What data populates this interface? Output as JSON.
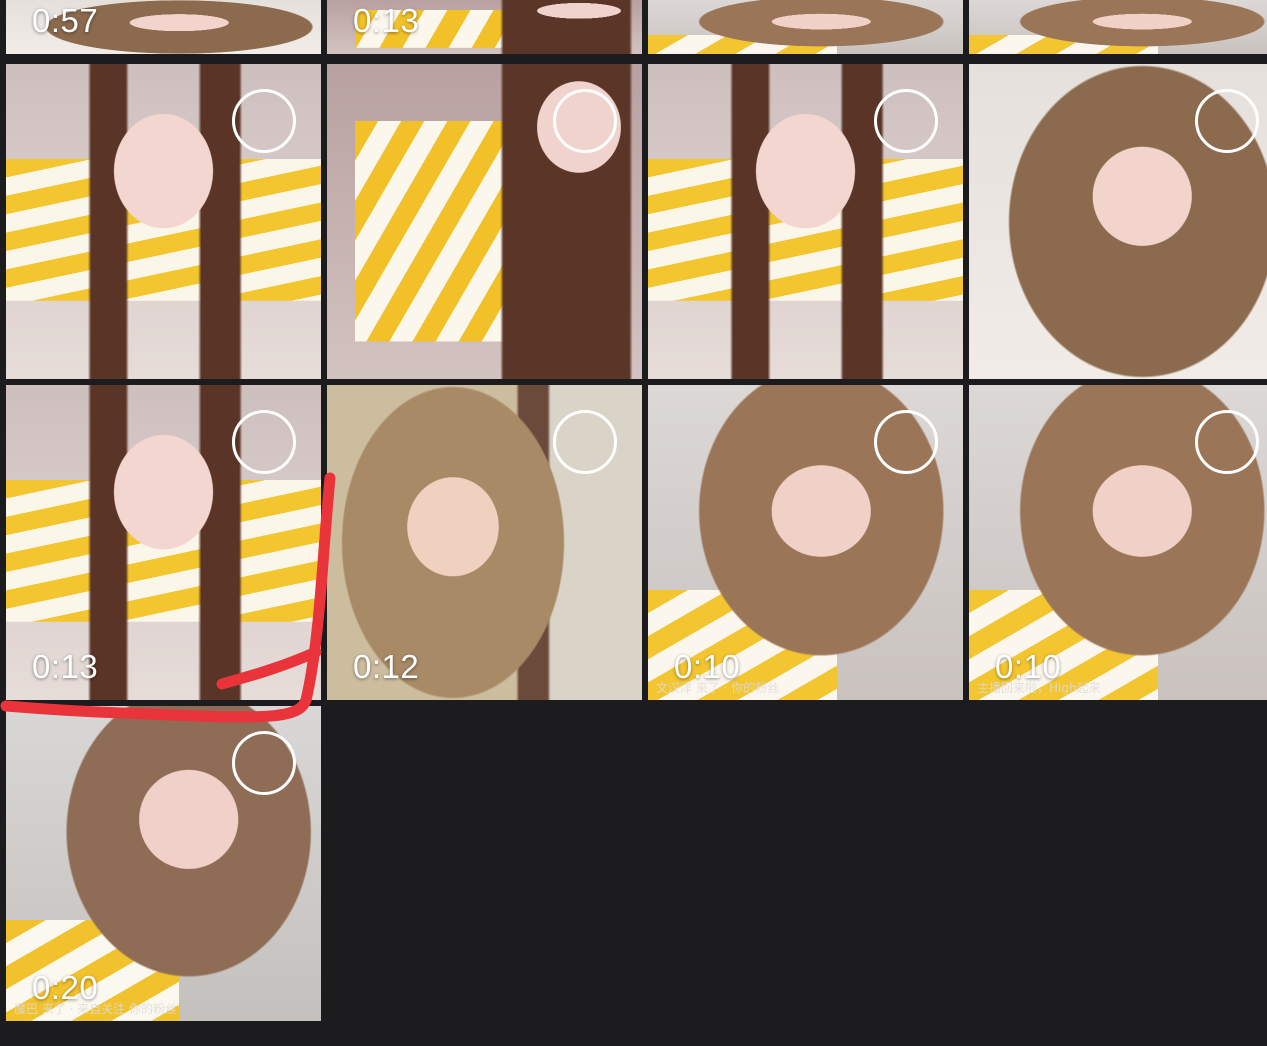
{
  "background_color": "#1c1c1e",
  "annotation_color": "#e8343a",
  "top_row": [
    {
      "duration": "0:57",
      "thumb": "bg-c"
    },
    {
      "duration": "0:13",
      "thumb": "bg-b"
    },
    {
      "duration": "",
      "thumb": "bg-e"
    },
    {
      "duration": "",
      "thumb": "bg-e"
    }
  ],
  "grid_rows": [
    [
      {
        "duration": "",
        "thumb": "bg-a",
        "overlay": ""
      },
      {
        "duration": "",
        "thumb": "bg-b",
        "overlay": ""
      },
      {
        "duration": "",
        "thumb": "bg-a",
        "overlay": ""
      },
      {
        "duration": "",
        "thumb": "bg-c",
        "overlay": ""
      }
    ],
    [
      {
        "duration": "0:13",
        "thumb": "bg-a",
        "overlay": ""
      },
      {
        "duration": "0:12",
        "thumb": "bg-d",
        "overlay": ""
      },
      {
        "duration": "0:10",
        "thumb": "bg-e",
        "overlay": "文汉洋 来了 · 你的粉丝"
      },
      {
        "duration": "0:10",
        "thumb": "bg-e",
        "overlay": "主播回来啦，High起来"
      }
    ],
    [
      {
        "duration": "0:20",
        "thumb": "bg-f",
        "overlay": "魔巴 来了 · 来自关注 你的粉丝"
      }
    ]
  ],
  "selection_icon": "circle-select-icon"
}
